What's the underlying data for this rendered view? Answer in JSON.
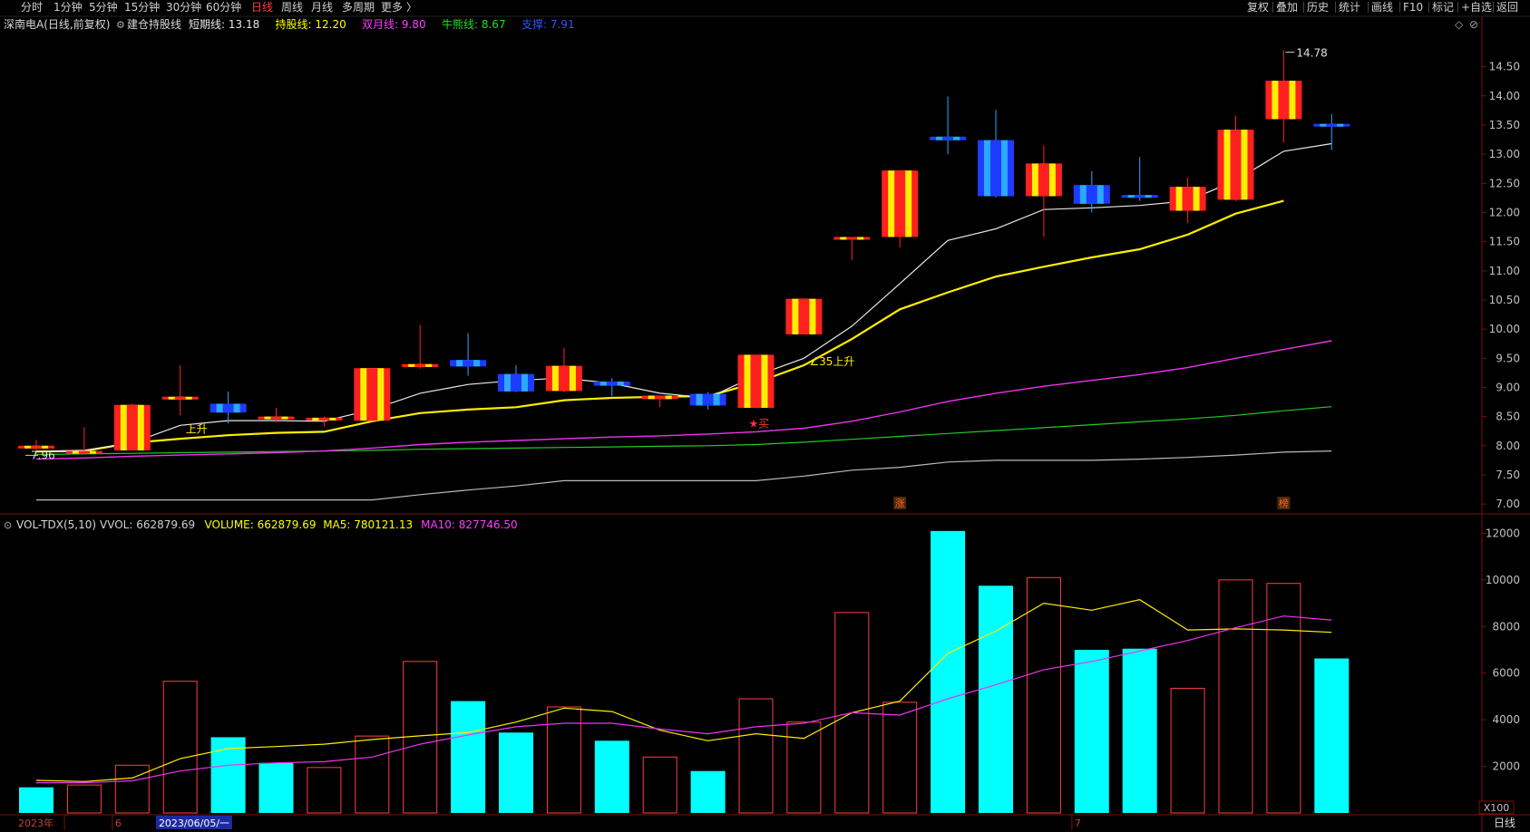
{
  "toolbar": {
    "periods": [
      "分时",
      "1分钟",
      "5分钟",
      "15分钟",
      "30分钟",
      "60分钟",
      "日线",
      "周线",
      "月线",
      "多周期",
      "更多 〉"
    ],
    "active_period": "日线",
    "tools": [
      "复权",
      "叠加",
      "历史",
      "统计",
      "画线",
      "F10",
      "标记",
      "+自选",
      "返回"
    ]
  },
  "chart_data": [
    {
      "type": "candlestick",
      "title": "深南电A(日线,前复权)",
      "indicator": "建仓持股线",
      "indicator_values": [
        {
          "label": "短期线:",
          "value": "13.18",
          "color": "#e8e8e8"
        },
        {
          "label": "持股线:",
          "value": "12.20",
          "color": "#ffff00"
        },
        {
          "label": "双月线:",
          "value": "9.80",
          "color": "#ff3cff"
        },
        {
          "label": "牛熊线:",
          "value": "8.67",
          "color": "#22dd22"
        },
        {
          "label": "支撑:",
          "value": "7.91",
          "color": "#3355ff"
        }
      ],
      "y_ticks": [
        7.0,
        7.5,
        8.0,
        8.5,
        9.0,
        9.5,
        10.0,
        10.5,
        11.0,
        11.5,
        12.0,
        12.5,
        13.0,
        13.5,
        14.0,
        14.5
      ],
      "ylim": [
        6.94,
        15.24
      ],
      "candles": [
        {
          "o": 7.96,
          "h": 8.1,
          "l": 7.85,
          "c": 8.0
        },
        {
          "o": 7.91,
          "h": 8.32,
          "l": 7.88,
          "c": 7.91
        },
        {
          "o": 7.92,
          "h": 8.72,
          "l": 7.92,
          "c": 8.7
        },
        {
          "o": 8.8,
          "h": 9.38,
          "l": 8.52,
          "c": 8.84
        },
        {
          "o": 8.72,
          "h": 8.93,
          "l": 8.38,
          "c": 8.57
        },
        {
          "o": 8.48,
          "h": 8.65,
          "l": 8.4,
          "c": 8.5
        },
        {
          "o": 8.44,
          "h": 8.5,
          "l": 8.33,
          "c": 8.48
        },
        {
          "o": 8.43,
          "h": 9.33,
          "l": 8.42,
          "c": 9.33
        },
        {
          "o": 9.35,
          "h": 10.07,
          "l": 9.32,
          "c": 9.4
        },
        {
          "o": 9.47,
          "h": 9.93,
          "l": 9.2,
          "c": 9.36
        },
        {
          "o": 9.23,
          "h": 9.38,
          "l": 8.92,
          "c": 8.93
        },
        {
          "o": 8.94,
          "h": 9.68,
          "l": 8.92,
          "c": 9.37
        },
        {
          "o": 9.1,
          "h": 9.16,
          "l": 8.85,
          "c": 9.03
        },
        {
          "o": 8.8,
          "h": 8.84,
          "l": 8.66,
          "c": 8.86
        },
        {
          "o": 8.89,
          "h": 8.92,
          "l": 8.62,
          "c": 8.69
        },
        {
          "o": 8.65,
          "h": 9.56,
          "l": 8.65,
          "c": 9.56
        },
        {
          "o": 9.91,
          "h": 10.52,
          "l": 9.91,
          "c": 10.52
        },
        {
          "o": 11.58,
          "h": 11.58,
          "l": 11.18,
          "c": 11.58
        },
        {
          "o": 11.58,
          "h": 12.72,
          "l": 11.4,
          "c": 12.72
        },
        {
          "o": 13.3,
          "h": 13.99,
          "l": 13.0,
          "c": 13.24
        },
        {
          "o": 13.24,
          "h": 13.76,
          "l": 12.26,
          "c": 12.28
        },
        {
          "o": 12.28,
          "h": 13.15,
          "l": 11.58,
          "c": 12.84
        },
        {
          "o": 12.47,
          "h": 12.71,
          "l": 12.0,
          "c": 12.15
        },
        {
          "o": 12.3,
          "h": 12.95,
          "l": 12.2,
          "c": 12.27
        },
        {
          "o": 12.03,
          "h": 12.6,
          "l": 11.82,
          "c": 12.44
        },
        {
          "o": 12.22,
          "h": 13.66,
          "l": 12.2,
          "c": 13.42
        },
        {
          "o": 13.6,
          "h": 14.78,
          "l": 13.2,
          "c": 14.26
        },
        {
          "o": 13.52,
          "h": 13.69,
          "l": 13.07,
          "c": 13.48
        }
      ],
      "short_line": [
        7.9,
        7.92,
        8.05,
        8.35,
        8.43,
        8.43,
        8.42,
        8.62,
        8.9,
        9.05,
        9.12,
        9.16,
        9.07,
        8.9,
        8.82,
        9.2,
        9.5,
        10.05,
        10.78,
        11.52,
        11.72,
        12.05,
        12.08,
        12.12,
        12.2,
        12.55,
        13.05,
        13.18
      ],
      "hold_line": [
        7.9,
        7.91,
        8.05,
        8.12,
        8.18,
        8.22,
        8.24,
        8.42,
        8.56,
        8.62,
        8.66,
        8.78,
        8.82,
        8.84,
        8.85,
        9.08,
        9.38,
        9.83,
        10.34,
        10.63,
        10.9,
        11.07,
        11.23,
        11.37,
        11.62,
        11.98,
        12.2
      ],
      "double_month_line": [
        7.77,
        7.79,
        7.82,
        7.84,
        7.86,
        7.88,
        7.91,
        7.96,
        8.02,
        8.06,
        8.09,
        8.12,
        8.15,
        8.17,
        8.2,
        8.24,
        8.3,
        8.42,
        8.58,
        8.76,
        8.9,
        9.02,
        9.12,
        9.22,
        9.34,
        9.5,
        9.65,
        9.8
      ],
      "bull_bear_line": [
        7.85,
        7.86,
        7.87,
        7.88,
        7.89,
        7.9,
        7.91,
        7.92,
        7.94,
        7.95,
        7.96,
        7.97,
        7.98,
        7.99,
        8.0,
        8.02,
        8.06,
        8.11,
        8.16,
        8.21,
        8.26,
        8.31,
        8.36,
        8.41,
        8.46,
        8.52,
        8.6,
        8.67
      ],
      "support_line": [
        7.07,
        7.07,
        7.07,
        7.07,
        7.07,
        7.07,
        7.07,
        7.07,
        7.16,
        7.24,
        7.31,
        7.4,
        7.4,
        7.4,
        7.4,
        7.4,
        7.48,
        7.58,
        7.63,
        7.72,
        7.75,
        7.75,
        7.75,
        7.77,
        7.8,
        7.84,
        7.89,
        7.91
      ],
      "annotations": [
        {
          "text": "14.78",
          "candle": 26,
          "value": 14.78,
          "kind": "high"
        },
        {
          "text": "7.96",
          "candle": 0,
          "value": 7.96,
          "kind": "low"
        },
        {
          "text": "∠35上升",
          "candle": 16,
          "value": 9.38,
          "kind": "note"
        },
        {
          "text": "上升",
          "candle": 3,
          "value": 8.22,
          "kind": "note"
        },
        {
          "text": "★买",
          "candle": 15,
          "value": 8.53,
          "kind": "signal"
        },
        {
          "text": "涨",
          "candle": 18,
          "kind": "badge"
        },
        {
          "text": "榜",
          "candle": 26,
          "kind": "badge"
        }
      ]
    },
    {
      "type": "bar",
      "title": "VOL-TDX(5,10)",
      "indicator_values": [
        {
          "label": "VVOL:",
          "value": "662879.69",
          "color": "#d0d0d0"
        },
        {
          "label": "VOLUME:",
          "value": "662879.69",
          "color": "#ffff00"
        },
        {
          "label": "MA5:",
          "value": "780121.13",
          "color": "#ffff00"
        },
        {
          "label": "MA10:",
          "value": "827746.50",
          "color": "#ff3cff"
        }
      ],
      "y_ticks": [
        2000,
        4000,
        6000,
        8000,
        10000,
        12000
      ],
      "ylim": [
        0,
        12600
      ],
      "unit": "X100",
      "values": [
        1100,
        1200,
        2050,
        5650,
        3250,
        2150,
        1950,
        3300,
        6500,
        4800,
        3450,
        4550,
        3100,
        2400,
        1800,
        4900,
        3900,
        8600,
        4750,
        12100,
        9750,
        10100,
        7000,
        7050,
        5350,
        10000,
        9850,
        6630
      ],
      "up": [
        false,
        true,
        true,
        true,
        false,
        false,
        true,
        true,
        true,
        false,
        false,
        true,
        false,
        true,
        false,
        true,
        true,
        true,
        true,
        false,
        false,
        true,
        false,
        false,
        true,
        true,
        true,
        false
      ],
      "ma5": [
        1400,
        1350,
        1500,
        2330,
        2760,
        2850,
        2950,
        3150,
        3310,
        3450,
        3900,
        4500,
        4350,
        3550,
        3100,
        3400,
        3200,
        4300,
        4800,
        6850,
        7800,
        9000,
        8700,
        9150,
        7850,
        7900,
        7850,
        7750
      ],
      "ma10": [
        1300,
        1300,
        1380,
        1800,
        2050,
        2150,
        2200,
        2400,
        2950,
        3350,
        3700,
        3850,
        3850,
        3600,
        3400,
        3700,
        3850,
        4300,
        4200,
        4900,
        5500,
        6150,
        6500,
        6950,
        7400,
        7950,
        8450,
        8280
      ]
    }
  ],
  "x_axis": {
    "labels": [
      {
        "text": "2023年",
        "candle": 0
      },
      {
        "text": "6",
        "candle": 1
      },
      {
        "text": "2023/06/05/一",
        "candle": 3
      },
      {
        "text": "7",
        "candle": 21
      }
    ],
    "corner_label": "日线"
  },
  "colors": {
    "bull_outer": "#ff2020",
    "bull_inner": "#ffee00",
    "bear_outer": "#1e3cff",
    "bear_inner": "#2aa8ff",
    "vol_bear": "#00ffff",
    "vol_bull": "#ff4040",
    "axis_text": "#c0c0c0",
    "grid_border": "#7a1010"
  }
}
